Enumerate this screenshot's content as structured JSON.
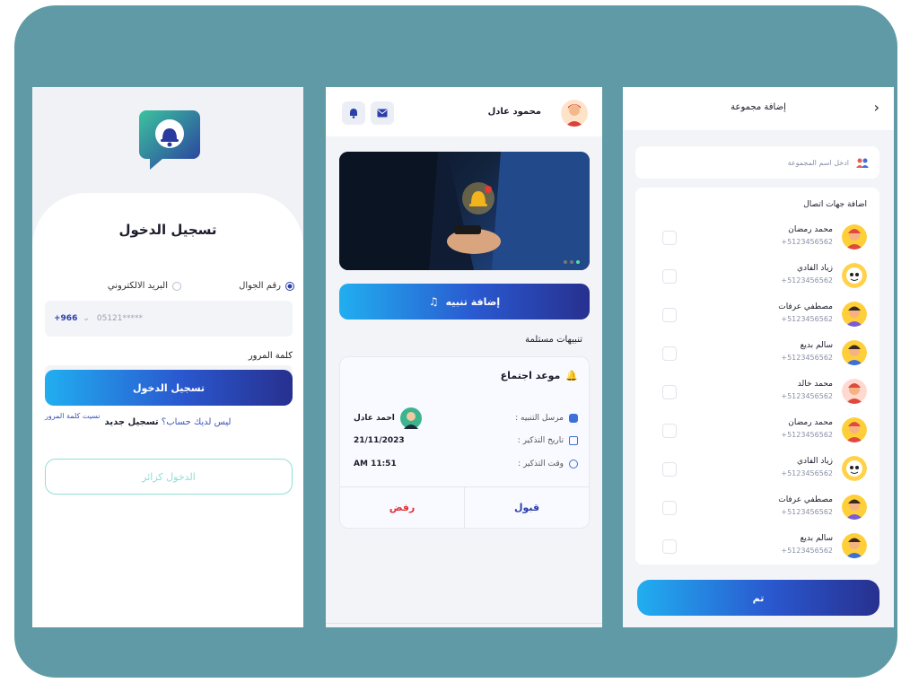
{
  "login": {
    "title": "تسجيل الدخول",
    "radio_phone": "رقم الجوال",
    "radio_email": "البريد الالكتروني",
    "country_code": "+966",
    "phone_placeholder": "05121*****",
    "password_label": "كلمة المرور",
    "password_value": "*******",
    "forgot": "نسيت كلمة المرور",
    "login_button": "تسجيل الدخول",
    "no_account": "ليس لديك حساب؟",
    "signup_link": "تسجيل جديد",
    "guest_button": "الدخول كزائر",
    "colors": {
      "accent": "#2a3faa",
      "guest_border": "#8fe0d2"
    }
  },
  "home": {
    "user_name": "محمود عادل",
    "add_alert_button": "إضافة تنبيه",
    "section_title": "تنبيهات مستلمة",
    "notification": {
      "title": "موعد اجتماع",
      "sender_label": "مرسل التنبيه :",
      "sender_name": "احمد عادل",
      "date_label": "تاريخ التذكير :",
      "date_value": "21/11/2023",
      "time_label": "وقت التذكير :",
      "time_value": "11:51 AM",
      "accept": "قبول",
      "reject": "رفض"
    },
    "icons": [
      "bell-icon",
      "mail-icon"
    ]
  },
  "group": {
    "title": "إضافة مجموعة",
    "name_placeholder": "ادخل اسم المجموعة",
    "contacts_header": "اضافة جهات اتصال",
    "contacts": [
      {
        "name": "محمد رمضان",
        "phone": "+5123456562"
      },
      {
        "name": "زياد الفادي",
        "phone": "+5123456562"
      },
      {
        "name": "مصطفي عرفات",
        "phone": "+5123456562"
      },
      {
        "name": "سالم بديع",
        "phone": "+5123456562"
      },
      {
        "name": "محمد خالد",
        "phone": "+5123456562"
      },
      {
        "name": "محمد رمضان",
        "phone": "+5123456562"
      },
      {
        "name": "زياد الفادي",
        "phone": "+5123456562"
      },
      {
        "name": "مصطفي عرفات",
        "phone": "+5123456562"
      },
      {
        "name": "سالم بديع",
        "phone": "+5123456562"
      }
    ],
    "done_button": "تم"
  }
}
